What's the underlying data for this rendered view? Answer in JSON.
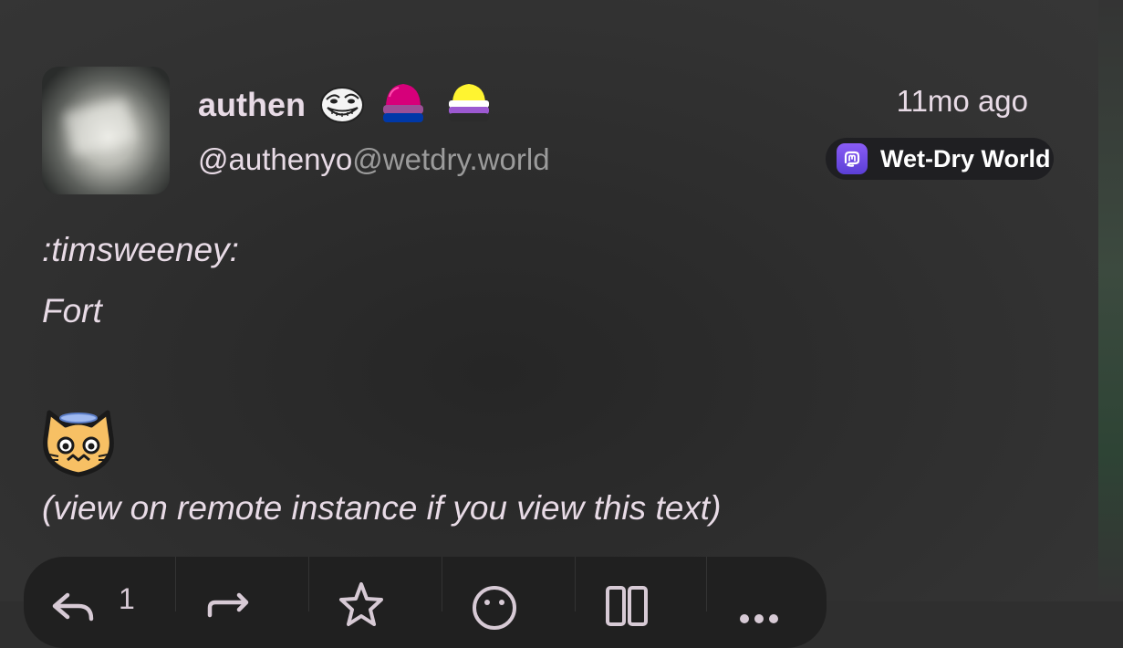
{
  "post": {
    "author": {
      "display_name": "authen",
      "name_emojis": [
        "troll-face-emoji",
        "bisexual-flag-hat-emoji",
        "nonbinary-flag-hat-emoji"
      ],
      "handle_user": "@authenyo",
      "handle_domain": "@wetdry.world"
    },
    "timestamp": "11mo ago",
    "instance": {
      "name": "Wet-Dry World",
      "icon": "mastodon-icon",
      "icon_color": "#6d4de6"
    },
    "content": {
      "line1": ":timsweeney:",
      "line2": "Fort",
      "emoji": "angel-cat-emoji",
      "note": "(view on remote instance if you view this text)"
    },
    "actions": {
      "reply_count": "1",
      "items": [
        "reply-icon",
        "boost-icon",
        "favourite-icon",
        "react-icon",
        "bookmark-icon",
        "more-icon"
      ]
    }
  },
  "colors": {
    "background": "#2f2f2f",
    "text": "#e8dbe6",
    "muted": "#9b9b9b",
    "badge_bg": "#1f1f22",
    "action_bar_bg": "#202020"
  }
}
